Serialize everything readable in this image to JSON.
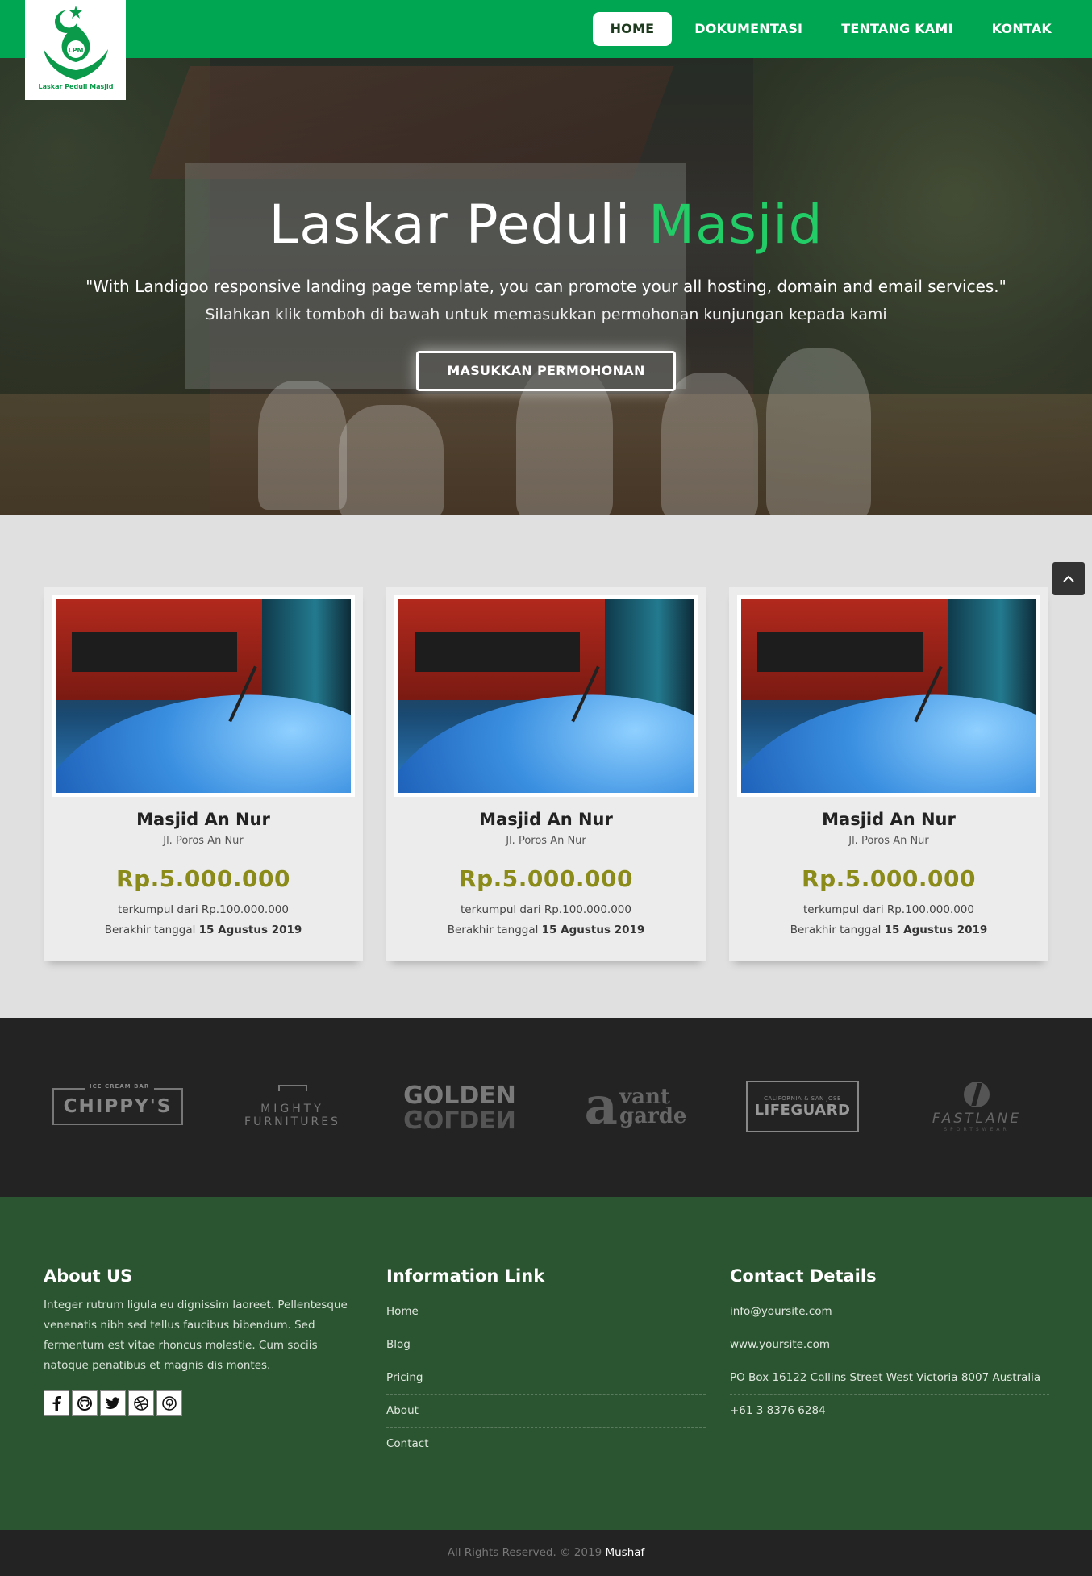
{
  "nav": {
    "items": [
      {
        "label": "HOME",
        "active": true
      },
      {
        "label": "DOKUMENTASI",
        "active": false
      },
      {
        "label": "TENTANG KAMI",
        "active": false
      },
      {
        "label": "KONTAK",
        "active": false
      }
    ]
  },
  "logo": {
    "icon": "mosque-hands-logo-icon",
    "text": "Laskar Peduli Masjid"
  },
  "hero": {
    "title_main": "Laskar Peduli ",
    "title_accent": "Masjid",
    "quote": "\"With Landigoo responsive landing page template, you can promote your all hosting, domain and email services.\"",
    "subtitle": "Silahkan klik tomboh di bawah untuk memasukkan permohonan kunjungan kepada kami",
    "button": "MASUKKAN PERMOHONAN"
  },
  "campaigns": [
    {
      "name": "Masjid An Nur",
      "address": "Jl. Poros An Nur",
      "amount": "Rp.5.000.000",
      "raised_text": "terkumpul dari Rp.100.000.000",
      "ends_label": "Berakhir tanggal ",
      "ends_date": "15 Agustus 2019"
    },
    {
      "name": "Masjid An Nur",
      "address": "Jl. Poros An Nur",
      "amount": "Rp.5.000.000",
      "raised_text": "terkumpul dari Rp.100.000.000",
      "ends_label": "Berakhir tanggal ",
      "ends_date": "15 Agustus 2019"
    },
    {
      "name": "Masjid An Nur",
      "address": "Jl. Poros An Nur",
      "amount": "Rp.5.000.000",
      "raised_text": "terkumpul dari Rp.100.000.000",
      "ends_label": "Berakhir tanggal ",
      "ends_date": "15 Agustus 2019"
    }
  ],
  "clients": {
    "chippys": {
      "top": "ICE CREAM BAR",
      "name": "CHIPPY'S"
    },
    "mighty": {
      "line1": "MIGHTY",
      "line2": "FURNITURES"
    },
    "golden": {
      "name": "GOLDEN"
    },
    "avant": {
      "letter": "a",
      "line1": "vant",
      "line2": "garde"
    },
    "lifeguard": {
      "top": "CALIFORNIA & SAN JOSE",
      "name": "LIFEGUARD"
    },
    "fastlane": {
      "name": "FASTLANE",
      "sub": "SPORTSWEAR"
    }
  },
  "footer": {
    "about": {
      "title": "About US",
      "text": "Integer rutrum ligula eu dignissim laoreet. Pellentesque venenatis nibh sed tellus faucibus bibendum. Sed fermentum est vitae rhoncus molestie. Cum sociis natoque penatibus et magnis dis montes.",
      "social_icons": [
        "facebook-icon",
        "github-icon",
        "twitter-icon",
        "dribbble-icon",
        "pinterest-icon"
      ]
    },
    "links": {
      "title": "Information Link",
      "items": [
        "Home",
        "Blog",
        "Pricing",
        "About",
        "Contact"
      ]
    },
    "contact": {
      "title": "Contact Details",
      "items": [
        "info@yoursite.com",
        "www.yoursite.com",
        "PO Box 16122 Collins Street West Victoria 8007 Australia",
        "+61 3 8376 6284"
      ]
    }
  },
  "copyright": {
    "text": "All Rights Reserved. © 2019 ",
    "author": "Mushaf"
  },
  "colors": {
    "brand_green": "#00a651",
    "accent_green": "#22cc66",
    "amount_olive": "#8b8b1a",
    "footer_green": "#2b5530"
  }
}
